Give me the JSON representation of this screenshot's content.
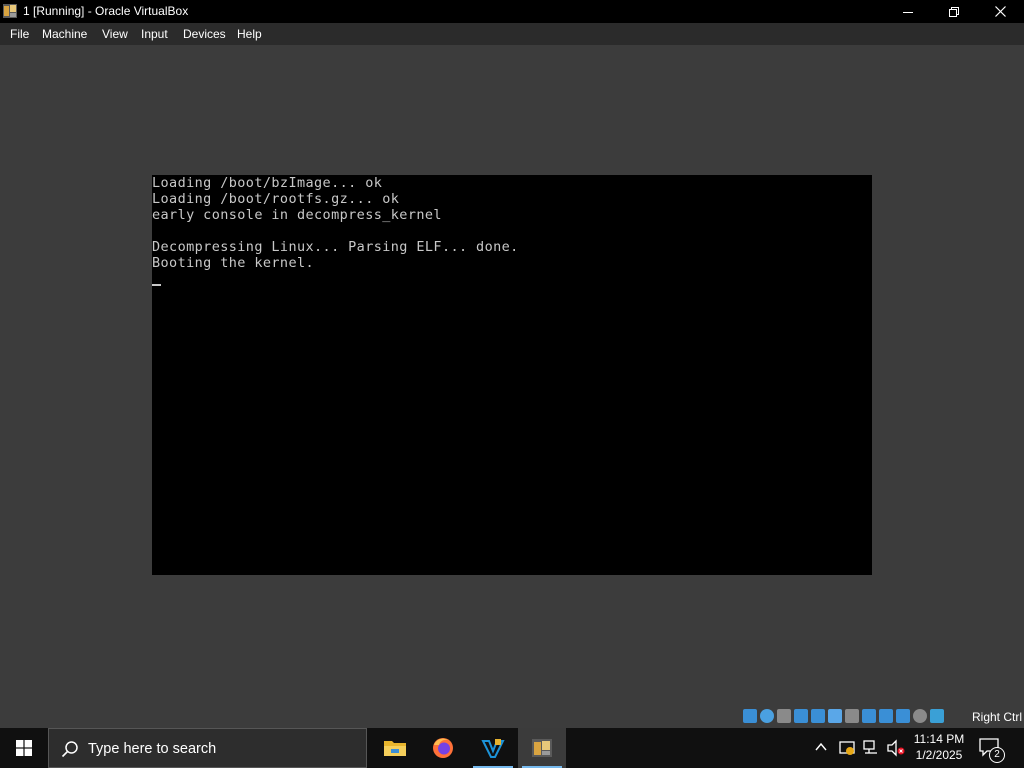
{
  "window": {
    "title": "1 [Running] - Oracle VirtualBox"
  },
  "menu": {
    "items": [
      "File",
      "Machine",
      "View",
      "Input",
      "Devices",
      "Help"
    ]
  },
  "console": {
    "lines": [
      "Loading /boot/bzImage... ok",
      "Loading /boot/rootfs.gz... ok",
      "early console in decompress_kernel",
      "",
      "Decompressing Linux... Parsing ELF... done.",
      "Booting the kernel."
    ]
  },
  "statusbar": {
    "icons": [
      "hard-disk-icon",
      "optical-drive-icon",
      "floppy-icon",
      "audio-icon",
      "network-icon",
      "usb-icon",
      "shared-folders-icon",
      "display-icon",
      "recording-icon",
      "vt-x-icon",
      "mouse-integration-icon",
      "keyboard-capture-icon"
    ],
    "host_key": "Right Ctrl"
  },
  "taskbar": {
    "search_placeholder": "Type here to search",
    "apps": [
      "file-explorer-icon",
      "firefox-icon",
      "visual-studio-code-icon",
      "virtualbox-icon"
    ],
    "clock_time": "11:14 PM",
    "clock_date": "1/2/2025",
    "notification_count": "2"
  },
  "colors": {
    "titlebar": "#000000",
    "menubar": "#2b2b2b",
    "vm_background": "#3c3c3c",
    "console_background": "#000000",
    "console_text": "#c8c8c8",
    "taskbar": "#101010",
    "taskbar_accent": "#76b9ed"
  }
}
